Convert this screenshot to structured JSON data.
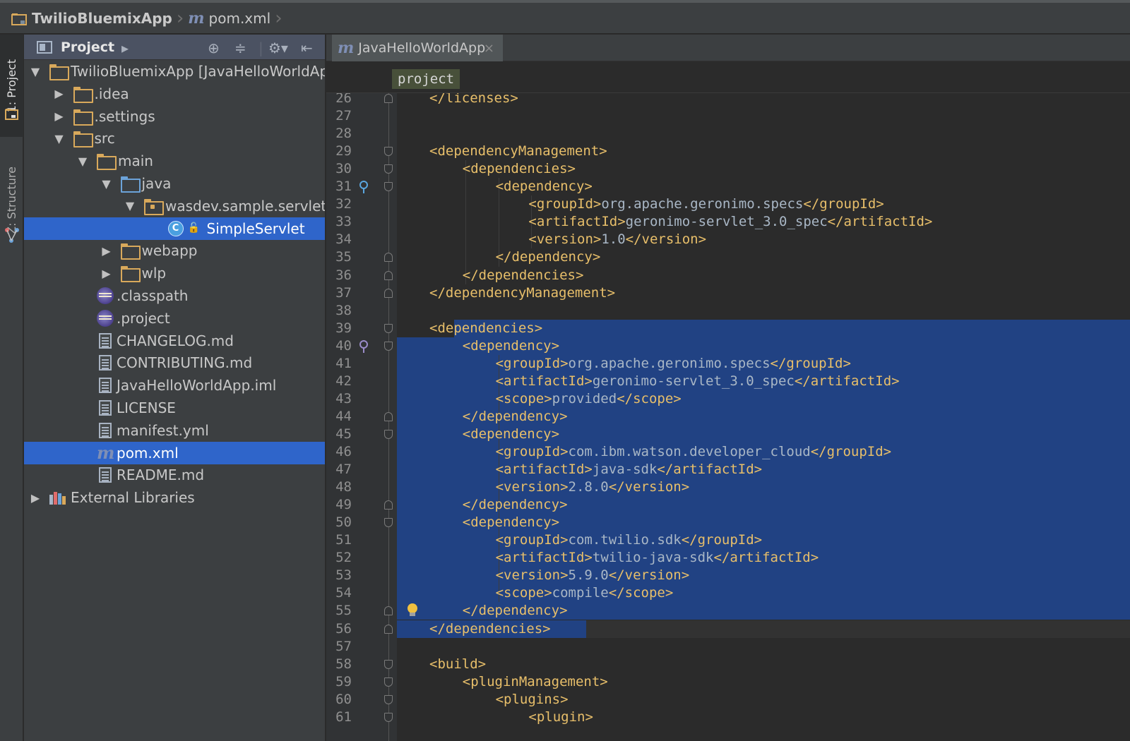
{
  "breadcrumb": {
    "project": "TwilioBluemixApp",
    "file": "pom.xml",
    "m_glyph": "m"
  },
  "stripe": {
    "project_tab": "1: Project",
    "structure_tab": "Z: Structure"
  },
  "project_panel": {
    "title": "Project",
    "tree": [
      {
        "label": "TwilioBluemixApp [JavaHelloWorldAp",
        "kind": "module",
        "depth": 0,
        "arrow": "down"
      },
      {
        "label": ".idea",
        "kind": "folder",
        "depth": 1,
        "arrow": "right"
      },
      {
        "label": ".settings",
        "kind": "folder",
        "depth": 1,
        "arrow": "right"
      },
      {
        "label": "src",
        "kind": "folder",
        "depth": 1,
        "arrow": "down"
      },
      {
        "label": "main",
        "kind": "folder",
        "depth": 2,
        "arrow": "down"
      },
      {
        "label": "java",
        "kind": "folder-blue",
        "depth": 3,
        "arrow": "down"
      },
      {
        "label": "wasdev.sample.servlet",
        "kind": "package",
        "depth": 4,
        "arrow": "down"
      },
      {
        "label": "SimpleServlet",
        "kind": "class",
        "depth": 5,
        "arrow": "",
        "selected": true
      },
      {
        "label": "webapp",
        "kind": "folder",
        "depth": 3,
        "arrow": "right"
      },
      {
        "label": "wlp",
        "kind": "folder",
        "depth": 3,
        "arrow": "right"
      },
      {
        "label": ".classpath",
        "kind": "eclipse",
        "depth": 2,
        "arrow": ""
      },
      {
        "label": ".project",
        "kind": "eclipse",
        "depth": 2,
        "arrow": ""
      },
      {
        "label": "CHANGELOG.md",
        "kind": "file",
        "depth": 2,
        "arrow": ""
      },
      {
        "label": "CONTRIBUTING.md",
        "kind": "file",
        "depth": 2,
        "arrow": ""
      },
      {
        "label": "JavaHelloWorldApp.iml",
        "kind": "file",
        "depth": 2,
        "arrow": ""
      },
      {
        "label": "LICENSE",
        "kind": "file",
        "depth": 2,
        "arrow": ""
      },
      {
        "label": "manifest.yml",
        "kind": "file",
        "depth": 2,
        "arrow": ""
      },
      {
        "label": "pom.xml",
        "kind": "maven",
        "depth": 2,
        "arrow": "",
        "selected": true
      },
      {
        "label": "README.md",
        "kind": "file",
        "depth": 2,
        "arrow": ""
      },
      {
        "label": "External Libraries",
        "kind": "extlib",
        "depth": 0,
        "arrow": "right"
      }
    ]
  },
  "editor": {
    "tab_label": "JavaHelloWorldApp",
    "tab_close": "×",
    "xml_breadcrumb": "project",
    "lines": [
      {
        "n": "26",
        "indent": 1,
        "parts": [
          [
            "tag",
            "</licenses>"
          ]
        ]
      },
      {
        "n": "27",
        "indent": 0,
        "parts": []
      },
      {
        "n": "28",
        "indent": 0,
        "parts": []
      },
      {
        "n": "29",
        "indent": 1,
        "parts": [
          [
            "tag",
            "<dependencyManagement>"
          ]
        ]
      },
      {
        "n": "30",
        "indent": 2,
        "parts": [
          [
            "tag",
            "<dependencies>"
          ]
        ]
      },
      {
        "n": "31",
        "indent": 3,
        "parts": [
          [
            "tag",
            "<dependency>"
          ]
        ]
      },
      {
        "n": "32",
        "indent": 4,
        "parts": [
          [
            "tag",
            "<groupId>"
          ],
          [
            "txt",
            "org.apache.geronimo.specs"
          ],
          [
            "tag",
            "</groupId>"
          ]
        ]
      },
      {
        "n": "33",
        "indent": 4,
        "parts": [
          [
            "tag",
            "<artifactId>"
          ],
          [
            "txt",
            "geronimo-servlet_3.0_spec"
          ],
          [
            "tag",
            "</artifactId>"
          ]
        ]
      },
      {
        "n": "34",
        "indent": 4,
        "parts": [
          [
            "tag",
            "<version>"
          ],
          [
            "txt",
            "1.0"
          ],
          [
            "tag",
            "</version>"
          ]
        ]
      },
      {
        "n": "35",
        "indent": 3,
        "parts": [
          [
            "tag",
            "</dependency>"
          ]
        ]
      },
      {
        "n": "36",
        "indent": 2,
        "parts": [
          [
            "tag",
            "</dependencies>"
          ]
        ]
      },
      {
        "n": "37",
        "indent": 1,
        "parts": [
          [
            "tag",
            "</dependencyManagement>"
          ]
        ]
      },
      {
        "n": "38",
        "indent": 0,
        "parts": []
      },
      {
        "n": "39",
        "indent": 1,
        "parts": [
          [
            "tag",
            "<dependencies>"
          ]
        ]
      },
      {
        "n": "40",
        "indent": 2,
        "parts": [
          [
            "tag",
            "<dependency>"
          ]
        ]
      },
      {
        "n": "41",
        "indent": 3,
        "parts": [
          [
            "tag",
            "<groupId>"
          ],
          [
            "txt",
            "org.apache.geronimo.specs"
          ],
          [
            "tag",
            "</groupId>"
          ]
        ]
      },
      {
        "n": "42",
        "indent": 3,
        "parts": [
          [
            "tag",
            "<artifactId>"
          ],
          [
            "txt",
            "geronimo-servlet_3.0_spec"
          ],
          [
            "tag",
            "</artifactId>"
          ]
        ]
      },
      {
        "n": "43",
        "indent": 3,
        "parts": [
          [
            "tag",
            "<scope>"
          ],
          [
            "txt",
            "provided"
          ],
          [
            "tag",
            "</scope>"
          ]
        ]
      },
      {
        "n": "44",
        "indent": 2,
        "parts": [
          [
            "tag",
            "</dependency>"
          ]
        ]
      },
      {
        "n": "45",
        "indent": 2,
        "parts": [
          [
            "tag",
            "<dependency>"
          ]
        ]
      },
      {
        "n": "46",
        "indent": 3,
        "parts": [
          [
            "tag",
            "<groupId>"
          ],
          [
            "txt",
            "com.ibm.watson.developer_cloud"
          ],
          [
            "tag",
            "</groupId>"
          ]
        ]
      },
      {
        "n": "47",
        "indent": 3,
        "parts": [
          [
            "tag",
            "<artifactId>"
          ],
          [
            "txt",
            "java-sdk"
          ],
          [
            "tag",
            "</artifactId>"
          ]
        ]
      },
      {
        "n": "48",
        "indent": 3,
        "parts": [
          [
            "tag",
            "<version>"
          ],
          [
            "txt",
            "2.8.0"
          ],
          [
            "tag",
            "</version>"
          ]
        ]
      },
      {
        "n": "49",
        "indent": 2,
        "parts": [
          [
            "tag",
            "</dependency>"
          ]
        ]
      },
      {
        "n": "50",
        "indent": 2,
        "parts": [
          [
            "tag",
            "<dependency>"
          ]
        ]
      },
      {
        "n": "51",
        "indent": 3,
        "parts": [
          [
            "tag",
            "<groupId>"
          ],
          [
            "txt",
            "com.twilio.sdk"
          ],
          [
            "tag",
            "</groupId>"
          ]
        ]
      },
      {
        "n": "52",
        "indent": 3,
        "parts": [
          [
            "tag",
            "<artifactId>"
          ],
          [
            "txt",
            "twilio-java-sdk"
          ],
          [
            "tag",
            "</artifactId>"
          ]
        ]
      },
      {
        "n": "53",
        "indent": 3,
        "parts": [
          [
            "tag",
            "<version>"
          ],
          [
            "txt",
            "5.9.0"
          ],
          [
            "tag",
            "</version>"
          ]
        ]
      },
      {
        "n": "54",
        "indent": 3,
        "parts": [
          [
            "tag",
            "<scope>"
          ],
          [
            "txt",
            "compile"
          ],
          [
            "tag",
            "</scope>"
          ]
        ]
      },
      {
        "n": "55",
        "indent": 2,
        "parts": [
          [
            "tag",
            "</dependency>"
          ]
        ]
      },
      {
        "n": "56",
        "indent": 1,
        "parts": [
          [
            "tag",
            "</dependencies>"
          ]
        ]
      },
      {
        "n": "57",
        "indent": 0,
        "parts": []
      },
      {
        "n": "58",
        "indent": 1,
        "parts": [
          [
            "tag",
            "<build>"
          ]
        ]
      },
      {
        "n": "59",
        "indent": 2,
        "parts": [
          [
            "tag",
            "<pluginManagement>"
          ]
        ]
      },
      {
        "n": "60",
        "indent": 3,
        "parts": [
          [
            "tag",
            "<plugins>"
          ]
        ]
      },
      {
        "n": "61",
        "indent": 4,
        "parts": [
          [
            "tag",
            "<plugin>"
          ]
        ]
      }
    ],
    "selection": {
      "from_line": "39",
      "to_line": "56"
    }
  },
  "colors": {
    "tag": "#e8bf6a",
    "text": "#a9b7c6",
    "selection": "#214283",
    "tree_selection": "#2f65ca",
    "folder": "#d9a95b"
  }
}
